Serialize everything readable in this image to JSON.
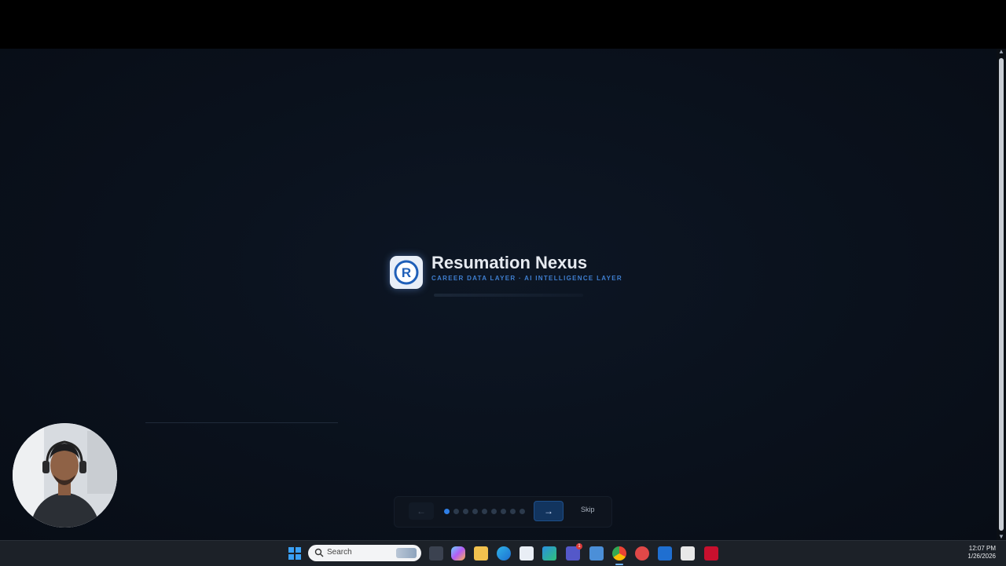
{
  "app": {
    "brand_name": "Resumation Nexus",
    "tagline": "CAREER DATA LAYER · AI INTELLIGENCE LAYER",
    "logo_letter": "R",
    "accent_color": "#2f7fe6"
  },
  "onboarding": {
    "prev_label": "←",
    "next_label": "→",
    "skip_label": "Skip",
    "total_steps": 9,
    "current_step": 1
  },
  "taskbar": {
    "search_placeholder": "Search",
    "clock_time": "12:07 PM",
    "clock_date": "1/26/2026",
    "notification_badge": "1",
    "icons": [
      "windows-start-icon",
      "task-view-icon",
      "copilot-icon",
      "file-explorer-icon",
      "edge-icon",
      "store-icon",
      "app-icon",
      "teams-icon",
      "app-icon",
      "chrome-icon",
      "app-icon",
      "outlook-icon",
      "app-icon",
      "mcafee-icon"
    ]
  }
}
